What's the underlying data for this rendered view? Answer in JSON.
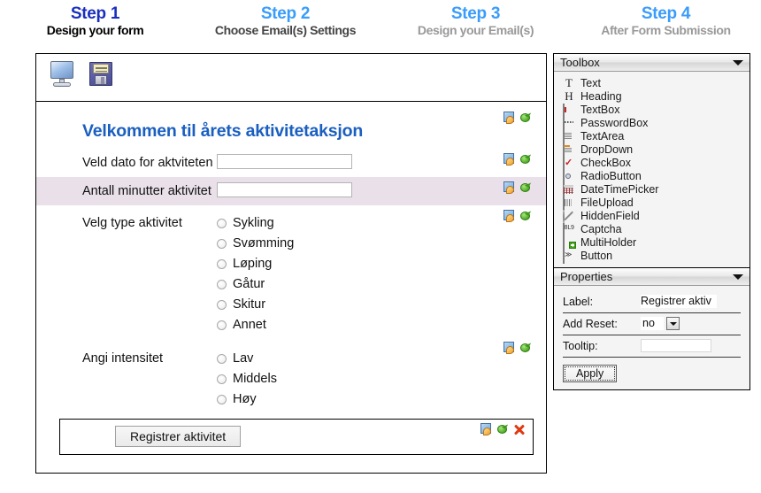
{
  "steps": [
    {
      "title": "Step 1",
      "subtitle": "Design your form"
    },
    {
      "title": "Step 2",
      "subtitle": "Choose Email(s) Settings"
    },
    {
      "title": "Step 3",
      "subtitle": "Design your Email(s)"
    },
    {
      "title": "Step 4",
      "subtitle": "After Form Submission"
    }
  ],
  "designer": {
    "toolbar": {
      "preview_icon": "monitor-preview-icon",
      "save_icon": "floppy-save-icon"
    },
    "heading": "Velkommen til årets aktivitetaksjon",
    "rows": [
      {
        "label": "Veld dato for aktviteten",
        "type": "textbox",
        "value": ""
      },
      {
        "label": "Antall minutter aktivitet",
        "type": "textbox",
        "value": ""
      }
    ],
    "radio_groups": [
      {
        "label": "Velg type aktivitet",
        "options": [
          "Sykling",
          "Svømming",
          "Løping",
          "Gåtur",
          "Skitur",
          "Annet"
        ]
      },
      {
        "label": "Angi intensitet",
        "options": [
          "Lav",
          "Middels",
          "Høy"
        ]
      }
    ],
    "submit_button": "Registrer aktivitet",
    "row_icons": {
      "edit": "edit-properties-icon",
      "move": "green-move-icon",
      "delete": "red-delete-icon"
    }
  },
  "toolbox": {
    "title": "Toolbox",
    "collapse_icon": "chevron-down-icon",
    "items": [
      {
        "label": "Text",
        "icon": "text-icon"
      },
      {
        "label": "Heading",
        "icon": "heading-icon"
      },
      {
        "label": "TextBox",
        "icon": "textbox-icon"
      },
      {
        "label": "PasswordBox",
        "icon": "passwordbox-icon"
      },
      {
        "label": "TextArea",
        "icon": "textarea-icon"
      },
      {
        "label": "DropDown",
        "icon": "dropdown-icon"
      },
      {
        "label": "CheckBox",
        "icon": "checkbox-icon"
      },
      {
        "label": "RadioButton",
        "icon": "radiobutton-icon"
      },
      {
        "label": "DateTimePicker",
        "icon": "datetimepicker-icon"
      },
      {
        "label": "FileUpload",
        "icon": "fileupload-icon"
      },
      {
        "label": "HiddenField",
        "icon": "hiddenfield-icon"
      },
      {
        "label": "Captcha",
        "icon": "captcha-icon"
      },
      {
        "label": "MultiHolder",
        "icon": "multiholder-icon"
      },
      {
        "label": "Button",
        "icon": "button-icon"
      }
    ]
  },
  "properties": {
    "title": "Properties",
    "collapse_icon": "chevron-down-icon",
    "fields": [
      {
        "label": "Label:",
        "value": "Registrer aktiv"
      },
      {
        "label": "Add Reset:",
        "value": "no"
      },
      {
        "label": "Tooltip:",
        "value": ""
      }
    ],
    "apply_label": "Apply"
  },
  "icon_glyphs": {
    "text": "T",
    "heading": "H",
    "captcha": "8L9",
    "button": "≫"
  }
}
